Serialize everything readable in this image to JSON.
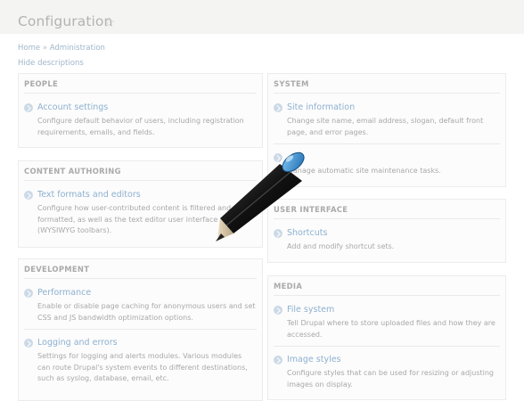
{
  "page": {
    "title": "Configuration"
  },
  "breadcrumb": {
    "home": "Home",
    "separator": "»",
    "admin": "Administration"
  },
  "hide_descriptions": "Hide descriptions",
  "panels": {
    "people": {
      "title": "PEOPLE",
      "items": [
        {
          "title": "Account settings",
          "desc": "Configure default behavior of users, including registration requirements, emails, and fields."
        }
      ]
    },
    "content_authoring": {
      "title": "CONTENT AUTHORING",
      "items": [
        {
          "title": "Text formats and editors",
          "desc": "Configure how user-contributed content is filtered and formatted, as well as the text editor user interface (WYSIWYG toolbars)."
        }
      ]
    },
    "development": {
      "title": "DEVELOPMENT",
      "items": [
        {
          "title": "Performance",
          "desc": "Enable or disable page caching for anonymous users and set CSS and JS bandwidth optimization options."
        },
        {
          "title": "Logging and errors",
          "desc": "Settings for logging and alerts modules. Various modules can route Drupal's system events to different destinations, such as syslog, database, email, etc."
        }
      ]
    },
    "system": {
      "title": "SYSTEM",
      "items": [
        {
          "title": "Site information",
          "desc": "Change site name, email address, slogan, default front page, and error pages."
        },
        {
          "title": "",
          "desc": "Manage automatic site maintenance tasks."
        }
      ]
    },
    "user_interface": {
      "title": "USER INTERFACE",
      "items": [
        {
          "title": "Shortcuts",
          "desc": "Add and modify shortcut sets."
        }
      ]
    },
    "media": {
      "title": "MEDIA",
      "items": [
        {
          "title": "File system",
          "desc": "Tell Drupal where to store uploaded files and how they are accessed."
        },
        {
          "title": "Image styles",
          "desc": "Configure styles that can be used for resizing or adjusting images on display."
        }
      ]
    }
  },
  "colors": {
    "link": "#9fb6cc",
    "header_bg": "#f4f4f2",
    "pencil_tip": "#3a8fd0"
  },
  "icons": {
    "favorite": "star-icon",
    "item_bullet": "chevron-icon",
    "overlay": "pencil-icon"
  }
}
